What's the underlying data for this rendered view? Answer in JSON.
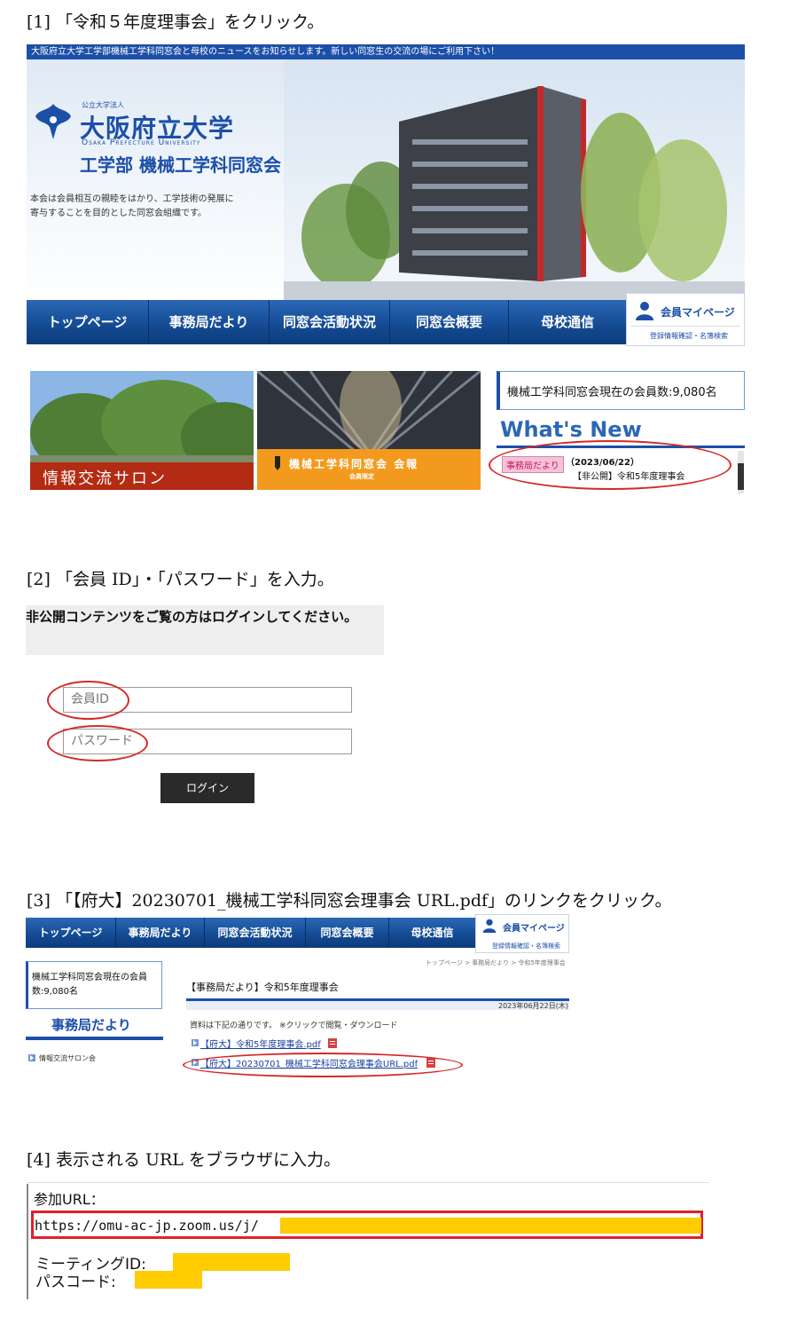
{
  "steps": {
    "s1": "[1] 「令和５年度理事会」をクリック。",
    "s2": "[2] 「会員 ID」・「パスワード」を入力。",
    "s3": "[3] 「【府大】20230701_機械工学科同窓会理事会 URL.pdf」のリンクをクリック。",
    "s4": "[4] 表示される URL をブラウザに入力。"
  },
  "site": {
    "top_strip": "大阪府立大学工学部機械工学科同窓会と母校のニュースをお知らせします。新しい同窓生の交流の場にご利用下さい！",
    "corp_label": "公立大学法人",
    "univ_name": "大阪府立大学",
    "univ_name_en": "Osaka Prefecture University",
    "dept_name": "工学部 機械工学科同窓会",
    "tagline_1": "本会は会員相互の親睦をはかり、工学技術の発展に",
    "tagline_2": "寄与することを目的とした同窓会組織です。",
    "nav": [
      "トップページ",
      "事務局だより",
      "同窓会活動状況",
      "同窓会概要",
      "母校通信"
    ],
    "mypage_label": "会員マイページ",
    "mypage_sub": "登録情報確認・名簿検索"
  },
  "tiles": {
    "salon": "情報交流サロン",
    "report": "機械工学科同窓会 会報",
    "report_sub": "会員限定"
  },
  "sidebar": {
    "member_count": "機械工学科同窓会現在の会員数:9,080名",
    "whats_new": "What's New",
    "news_tag": "事務局だより",
    "news_date": "（2023/06/22）",
    "news_title": "【非公開】令和5年度理事会"
  },
  "login": {
    "banner": "非公開コンテンツをご覧の方はログインしてください。",
    "id_placeholder": "会員ID",
    "pw_placeholder": "パスワード",
    "button": "ログイン"
  },
  "s3": {
    "nav": [
      "トップページ",
      "事務局だより",
      "同窓会活動状況",
      "同窓会概要",
      "母校通信"
    ],
    "mypage_label": "会員マイページ",
    "mypage_sub": "登録情報確認・名簿検索",
    "breadcrumb": "トップページ > 事務局だより > 令和5年度理事会",
    "member_count_1": "機械工学科同窓会現在の会員",
    "member_count_2": "数:9,080名",
    "side_heading": "事務局だより",
    "side_link": "情報交流サロン会",
    "page_title": "【事務局だより】令和5年度理事会",
    "date": "2023年06月22日(木)",
    "intro": "資料は下記の通りです。 ※クリックで閲覧・ダウンロード",
    "file1": "【府大】令和5年度理事会.pdf",
    "file2": "【府大】20230701_機械工学科同窓会理事会URL.pdf"
  },
  "s4": {
    "join_label": "参加URL：",
    "url_prefix": "https://omu-ac-jp.zoom.us/j/",
    "meeting_label": "ミーティングID:",
    "pass_label": "パスコード:"
  },
  "colors": {
    "nav_blue": "#134a92",
    "strip_blue": "#1c4fa8",
    "accent_orange": "#f39a1e",
    "salon_red": "#b32b12",
    "annotation_red": "#d42a2a",
    "redaction_yellow": "#ffcc00"
  }
}
